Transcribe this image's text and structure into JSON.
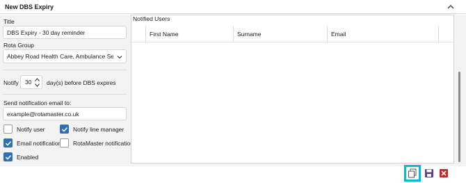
{
  "header": {
    "title": "New DBS Expiry"
  },
  "form": {
    "title_label": "Title",
    "title_value": "DBS Expiry - 30 day reminder",
    "rota_group_label": "Rota Group",
    "rota_group_value": "Abbey Road Health Care, Ambulance Servic...",
    "notify_label": "Notify",
    "notify_value": "30",
    "notify_suffix": "day(s) before DBS expires",
    "email_label": "Send notification email to:",
    "email_value": "example@rotamaster.co.uk"
  },
  "checkboxes": {
    "notify_user": {
      "label": "Notify user",
      "checked": false
    },
    "notify_line_manager": {
      "label": "Notify line manager",
      "checked": true
    },
    "email_notification": {
      "label": "Email notification",
      "checked": true
    },
    "rotamaster_notification": {
      "label": "RotaMaster notification",
      "checked": false
    },
    "enabled": {
      "label": "Enabled",
      "checked": true
    }
  },
  "notified_users": {
    "title": "Notified Users",
    "columns": [
      "First Name",
      "Surname",
      "Email"
    ]
  },
  "toolbar": {
    "copy_icon": "copy-icon",
    "save_icon": "save-icon",
    "close_icon": "close-icon",
    "colors": {
      "highlight": "#00bcd4",
      "save": "#5b3e8e",
      "close": "#c62828",
      "checkbox": "#2f6fb3"
    }
  }
}
